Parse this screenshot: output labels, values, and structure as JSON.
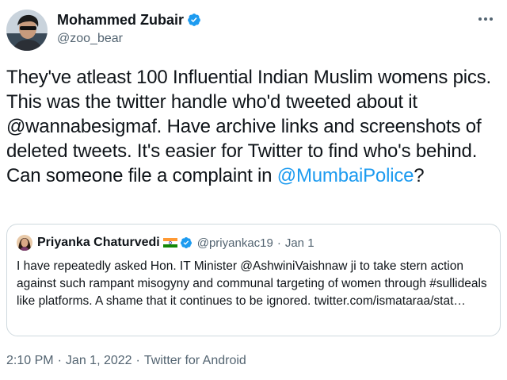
{
  "author": {
    "name": "Mohammed Zubair",
    "handle": "@zoo_bear"
  },
  "tweet": {
    "text_before": "They've atleast 100 Influential Indian Muslim womens pics. This was the twitter handle who'd tweeted about it @wannabesigmaf. Have archive links and screenshots of deleted tweets. It's easier for Twitter to find who's behind. Can someone file a complaint in ",
    "mention": "@MumbaiPolice",
    "text_after": "?"
  },
  "quoted": {
    "name": "Priyanka Chaturvedi",
    "handle": "@priyankac19",
    "separator": "·",
    "date": "Jan 1",
    "text": "I have repeatedly asked Hon. IT Minister @AshwiniVaishnaw ji to take stern action against such rampant misogyny and communal targeting of women through #sullideals like platforms. A shame that it continues to be ignored. twitter.com/ismataraa/stat…"
  },
  "meta": {
    "time": "2:10 PM",
    "sep1": "·",
    "date": "Jan 1, 2022",
    "sep2": "·",
    "source": "Twitter for Android"
  },
  "colors": {
    "accent": "#1d9bf0",
    "secondary_text": "#536471",
    "border": "#cfd9de"
  },
  "icons": {
    "verified": "verified-badge-icon",
    "more": "more-options-icon",
    "flag": "india-flag-icon"
  }
}
